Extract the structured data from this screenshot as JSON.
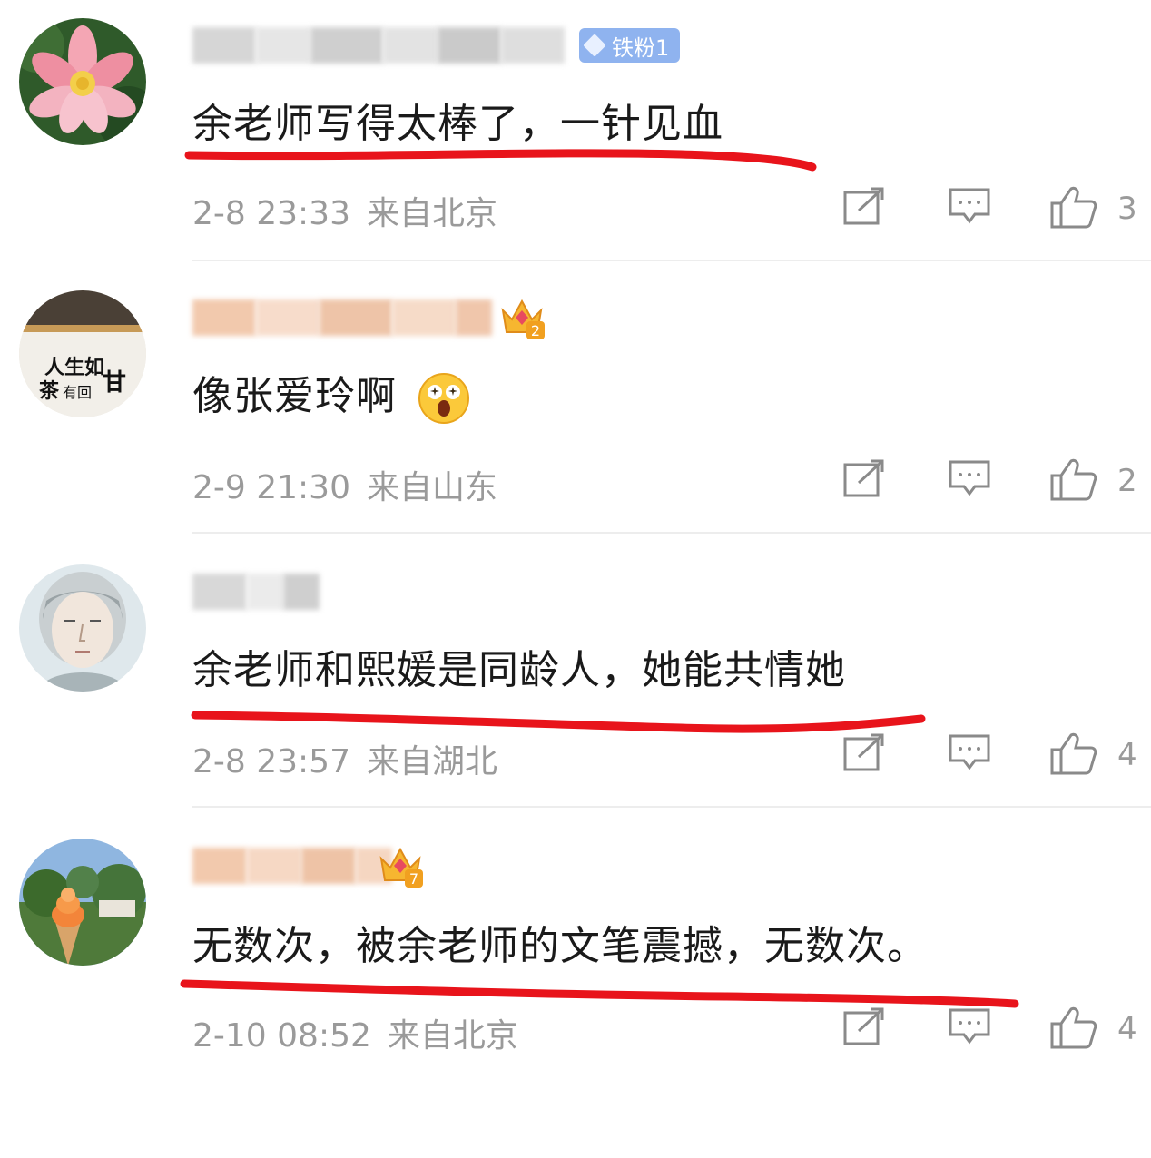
{
  "comments": [
    {
      "badge": "铁粉1",
      "text": "余老师写得太棒了，一针见血",
      "time": "2-8 23:33",
      "location": "来自北京",
      "likes": "3",
      "highlighted": true
    },
    {
      "crown_level": "2",
      "text": "像张爱玲啊",
      "time": "2-9 21:30",
      "location": "来自山东",
      "likes": "2",
      "highlighted": false
    },
    {
      "text": "余老师和熙媛是同龄人，她能共情她",
      "time": "2-8 23:57",
      "location": "来自湖北",
      "likes": "4",
      "highlighted": true
    },
    {
      "crown_level": "7",
      "text": "无数次，被余老师的文笔震撼，无数次。",
      "time": "2-10 08:52",
      "location": "来自北京",
      "likes": "4",
      "highlighted": true
    }
  ],
  "avatar_images": {
    "c0": "lotus flower",
    "c1": "calligraphy poster",
    "c2": "illustrated portrait",
    "c3": "ice cream cone outdoors"
  },
  "icons": [
    "repost-icon",
    "comment-icon",
    "like-icon"
  ],
  "colors": {
    "underline": "#e8141b",
    "meta_text": "#9a9a9a",
    "badge_bg": "#8fb3ef"
  }
}
